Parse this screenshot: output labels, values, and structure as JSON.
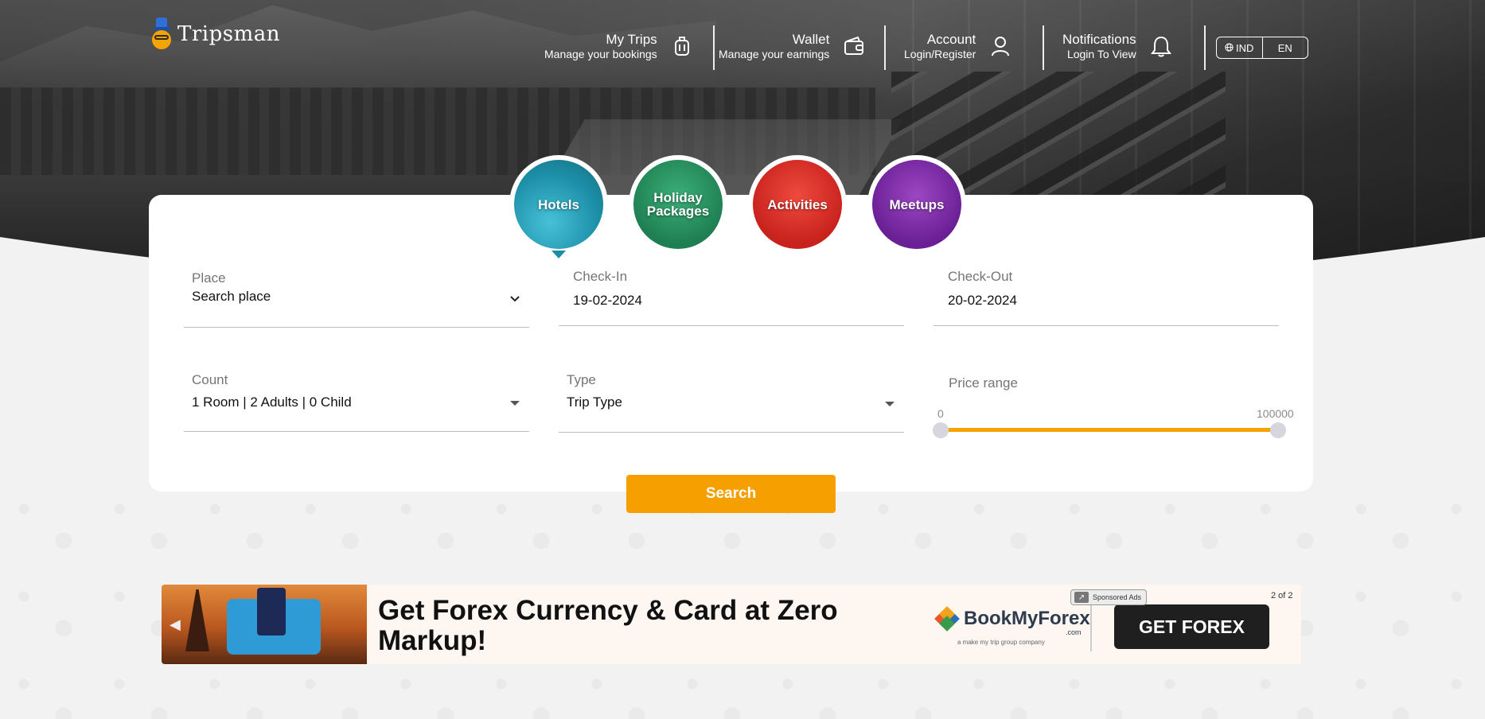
{
  "brand": {
    "name": "Tripsman"
  },
  "nav": {
    "my_trips": {
      "title": "My Trips",
      "subtitle": "Manage your bookings",
      "icon": "luggage-icon"
    },
    "wallet": {
      "title": "Wallet",
      "subtitle": "Manage your earnings",
      "icon": "wallet-icon"
    },
    "account": {
      "title": "Account",
      "subtitle": "Login/Register",
      "icon": "user-icon"
    },
    "notifications": {
      "title": "Notifications",
      "subtitle": "Login To View",
      "icon": "bell-icon"
    }
  },
  "locale": {
    "region": "IND",
    "language": "EN"
  },
  "tabs": [
    {
      "label": "Hotels",
      "active": true
    },
    {
      "label": "Holiday Packages",
      "active": false
    },
    {
      "label": "Activities",
      "active": false
    },
    {
      "label": "Meetups",
      "active": false
    }
  ],
  "form": {
    "place": {
      "label": "Place",
      "value": "Search place"
    },
    "check_in": {
      "label": "Check-In",
      "value": "19-02-2024"
    },
    "check_out": {
      "label": "Check-Out",
      "value": "20-02-2024"
    },
    "count": {
      "label": "Count",
      "value": "1 Room | 2 Adults | 0 Child"
    },
    "type": {
      "label": "Type",
      "value": "Trip Type"
    },
    "price_range": {
      "label": "Price range",
      "min": "0",
      "max": "100000",
      "selected_min_fraction": 0,
      "selected_max_fraction": 1
    },
    "search_label": "Search"
  },
  "ad": {
    "headline": "Get Forex Currency & Card at Zero Markup!",
    "brand": "BookMyForex",
    "brand_domain": ".com",
    "brand_tagline": "a make my trip group company",
    "cta": "GET FOREX",
    "sponsored": "Sponsored Ads",
    "counter": "2 of 2"
  },
  "colors": {
    "accent": "#f5a000",
    "hotels": "#1b8ea6",
    "holiday": "#1e7f52",
    "activities": "#c8221d",
    "meetups": "#6a1f95"
  }
}
